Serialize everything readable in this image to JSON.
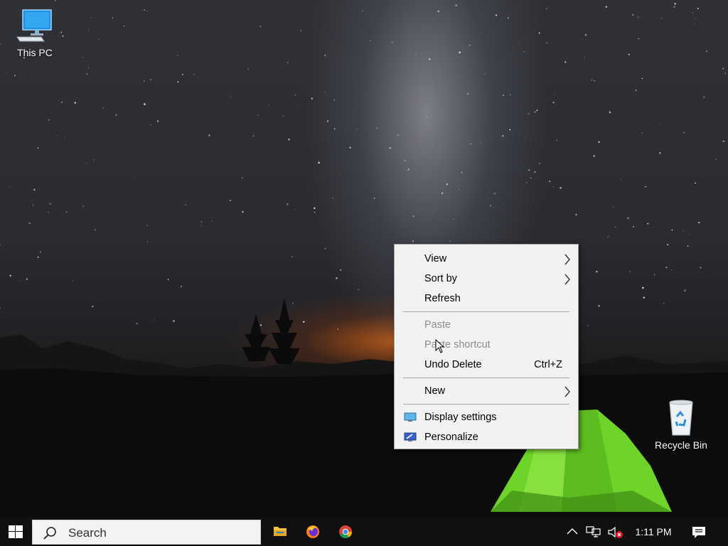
{
  "desktop": {
    "icons": [
      {
        "label": "This PC",
        "icon": "computer-icon"
      },
      {
        "label": "Recycle Bin",
        "icon": "recycle-bin-icon"
      }
    ]
  },
  "context_menu": {
    "items": [
      {
        "label": "View",
        "has_submenu": true,
        "enabled": true
      },
      {
        "label": "Sort by",
        "has_submenu": true,
        "enabled": true
      },
      {
        "label": "Refresh",
        "enabled": true
      },
      {
        "label": "Paste",
        "enabled": false
      },
      {
        "label": "Paste shortcut",
        "enabled": false
      },
      {
        "label": "Undo Delete",
        "shortcut": "Ctrl+Z",
        "enabled": true
      },
      {
        "label": "New",
        "has_submenu": true,
        "enabled": true
      },
      {
        "label": "Display settings",
        "icon": "display-settings-icon",
        "enabled": true
      },
      {
        "label": "Personalize",
        "icon": "personalize-icon",
        "enabled": true
      }
    ]
  },
  "taskbar": {
    "search_placeholder": "Search",
    "apps": [
      {
        "name": "File Explorer",
        "icon": "file-explorer-icon"
      },
      {
        "name": "Firefox",
        "icon": "firefox-icon"
      },
      {
        "name": "Chrome",
        "icon": "chrome-icon"
      }
    ],
    "tray": {
      "icons": [
        "chevron-up-icon",
        "network-icon",
        "volume-muted-icon",
        "notifications-icon"
      ],
      "time": "1:11 PM"
    }
  },
  "colors": {
    "taskbar": "#101011",
    "menu_background": "#f2f2f2",
    "disabled_text": "#8d8d8d",
    "tent_green": "#6fd42a"
  }
}
